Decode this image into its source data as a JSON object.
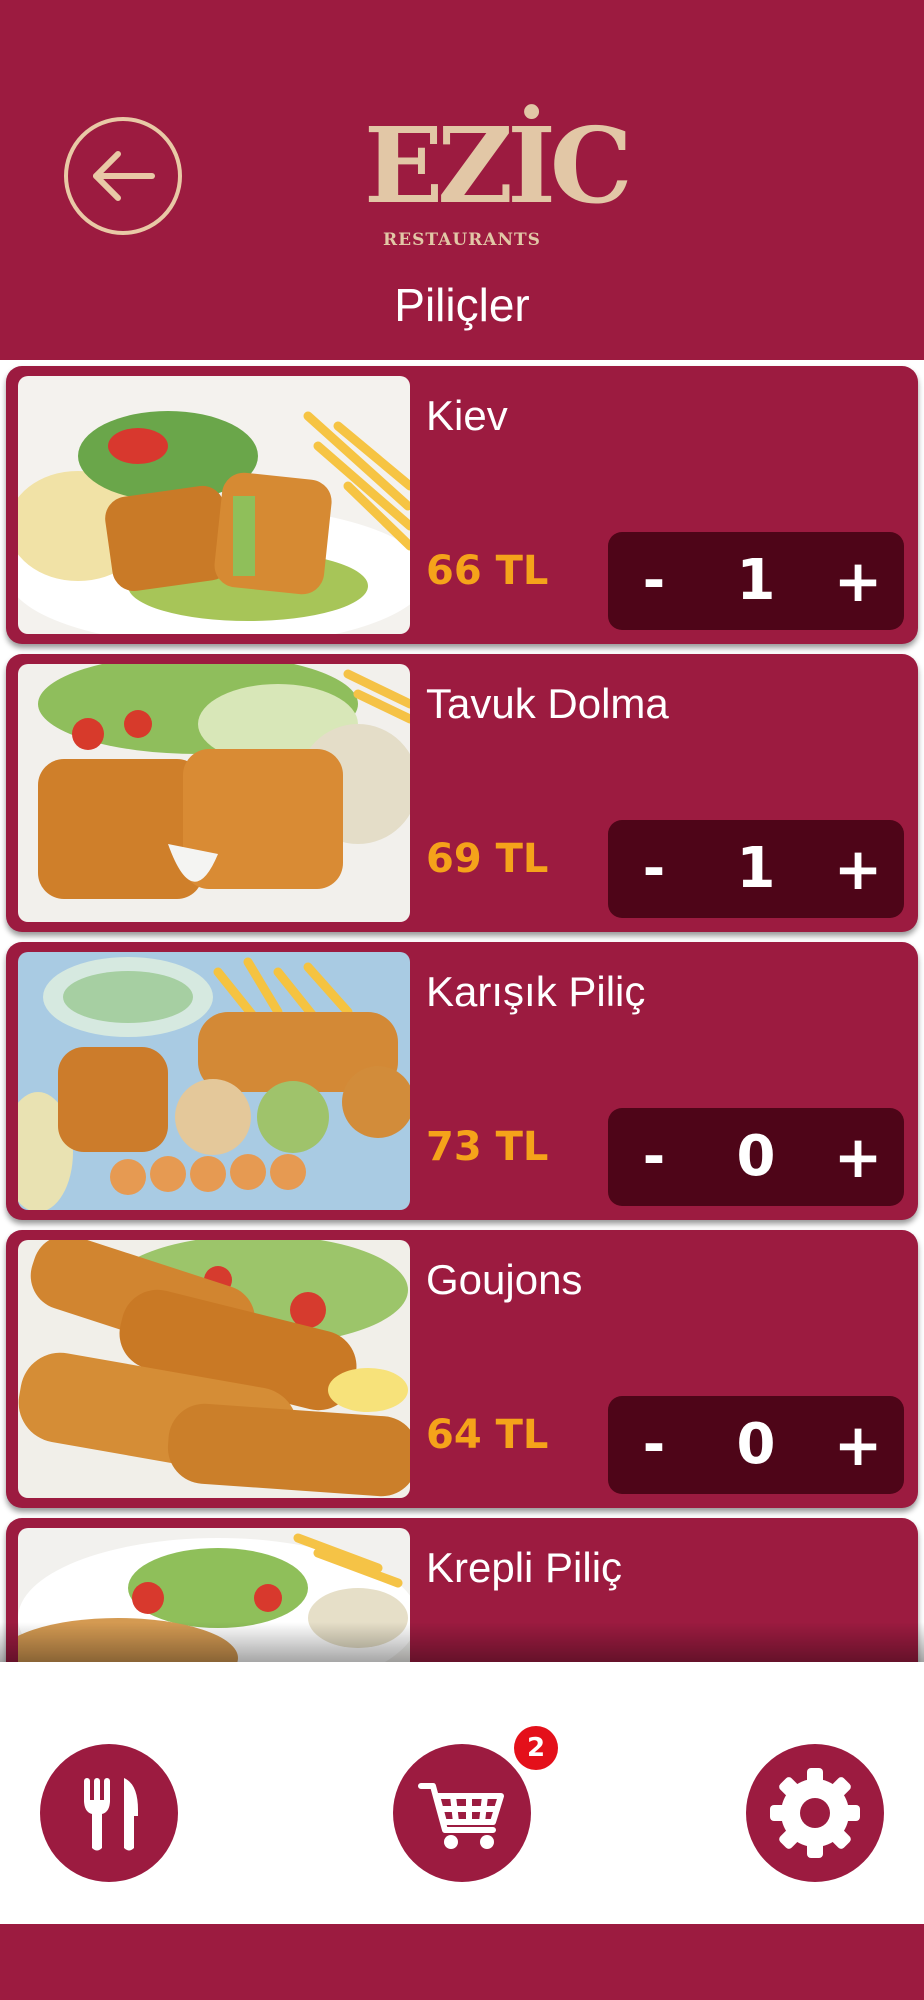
{
  "header": {
    "back_icon": "arrow-left-icon",
    "logo_text": "EZİC",
    "logo_subtext": "RESTAURANTS",
    "title": "Piliçler",
    "background": "#9c1b40",
    "logo_color": "#e2c7a6"
  },
  "products": [
    {
      "name": "Kiev",
      "price": "66 TL",
      "quantity": "1",
      "minus_label": "-",
      "plus_label": "+"
    },
    {
      "name": "Tavuk Dolma",
      "price": "69 TL",
      "quantity": "1",
      "minus_label": "-",
      "plus_label": "+"
    },
    {
      "name": "Karışık Piliç",
      "price": "73 TL",
      "quantity": "0",
      "minus_label": "-",
      "plus_label": "+"
    },
    {
      "name": "Goujons",
      "price": "64 TL",
      "quantity": "0",
      "minus_label": "-",
      "plus_label": "+"
    },
    {
      "name": "Krepli Piliç"
    }
  ],
  "bottom_nav": {
    "menu_icon": "fork-knife-icon",
    "cart_icon": "shopping-cart-icon",
    "cart_badge": "2",
    "settings_icon": "gear-icon",
    "badge_color": "#e4101a"
  },
  "colors": {
    "accent": "#9c1b40",
    "stepper_bg": "#4e0518",
    "price": "#f5a31a"
  }
}
